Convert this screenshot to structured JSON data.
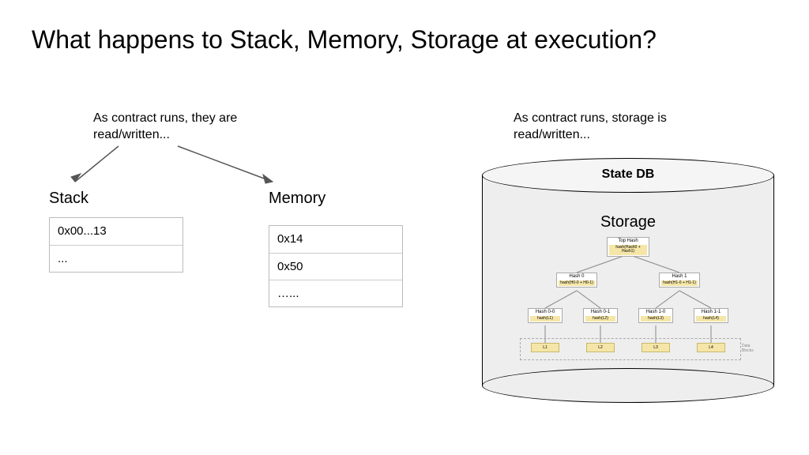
{
  "title": "What happens to Stack, Memory, Storage at execution?",
  "caption_left": "As contract runs, they are read/written...",
  "caption_right": "As contract runs, storage is read/written...",
  "stack": {
    "label": "Stack",
    "rows": [
      "0x00...13",
      "..."
    ]
  },
  "memory": {
    "label": "Memory",
    "rows": [
      "0x14",
      "0x50",
      "…..."
    ]
  },
  "db": {
    "title": "State DB",
    "storage_label": "Storage",
    "tree": {
      "top": {
        "label": "Top Hash",
        "sub": "hash(Hash0 + Hash1)"
      },
      "l1": [
        {
          "label": "Hash 0",
          "sub": "hash(H0-0 + H0-1)"
        },
        {
          "label": "Hash 1",
          "sub": "hash(H1-0 + H1-1)"
        }
      ],
      "l2": [
        {
          "label": "Hash 0-0",
          "sub": "hash(L1)"
        },
        {
          "label": "Hash 0-1",
          "sub": "hash(L2)"
        },
        {
          "label": "Hash 1-0",
          "sub": "hash(L3)"
        },
        {
          "label": "Hash 1-1",
          "sub": "hash(L4)"
        }
      ],
      "leaves": [
        "L1",
        "L2",
        "L3",
        "L4"
      ],
      "blocks_label": "Data Blocks"
    }
  }
}
